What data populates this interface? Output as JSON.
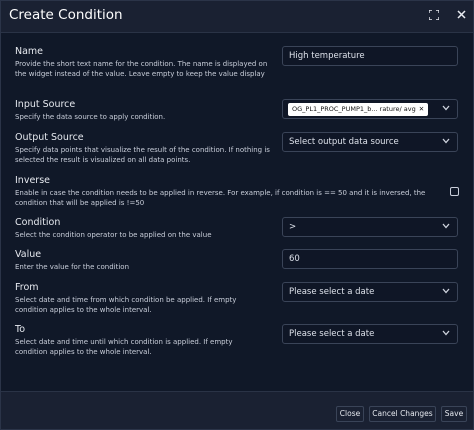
{
  "dialog": {
    "title": "Create Condition"
  },
  "fields": {
    "name": {
      "label": "Name",
      "description": "Provide the short text name for the condition. The name is displayed on the widget instead of the value. Leave empty to keep the value display",
      "value": "High temperature"
    },
    "input_source": {
      "label": "Input Source",
      "description": "Specify the data source to apply condition.",
      "chip": "OG_PL1_PROC_PUMP1_b... rature/ avg"
    },
    "output_source": {
      "label": "Output Source",
      "description": "Specify data points that visualize the result of the condition. If nothing is selected the result is visualized on all data points.",
      "placeholder": "Select output data source"
    },
    "inverse": {
      "label": "Inverse",
      "description": "Enable in case the condition needs to be applied in reverse. For example, if condition is == 50 and it is inversed, the condition that will be applied is !=50",
      "checked": false
    },
    "condition": {
      "label": "Condition",
      "description": "Select the condition operator to be applied on the value",
      "value": ">"
    },
    "value": {
      "label": "Value",
      "description": "Enter the value for the condition",
      "value": "60"
    },
    "from": {
      "label": "From",
      "description": "Select date and time from which condition be applied. If empty condition applies to the whole interval.",
      "placeholder": "Please select a date"
    },
    "to": {
      "label": "To",
      "description": "Select date and time until which condition is applied. If empty condition applies to the whole interval.",
      "placeholder": "Please select a date"
    }
  },
  "footer": {
    "close_label": "Close",
    "cancel_label": "Cancel Changes",
    "save_label": "Save"
  },
  "icons": {
    "maximize": "expand-icon",
    "close": "close-icon",
    "dropdown": "chevron-down-icon"
  }
}
